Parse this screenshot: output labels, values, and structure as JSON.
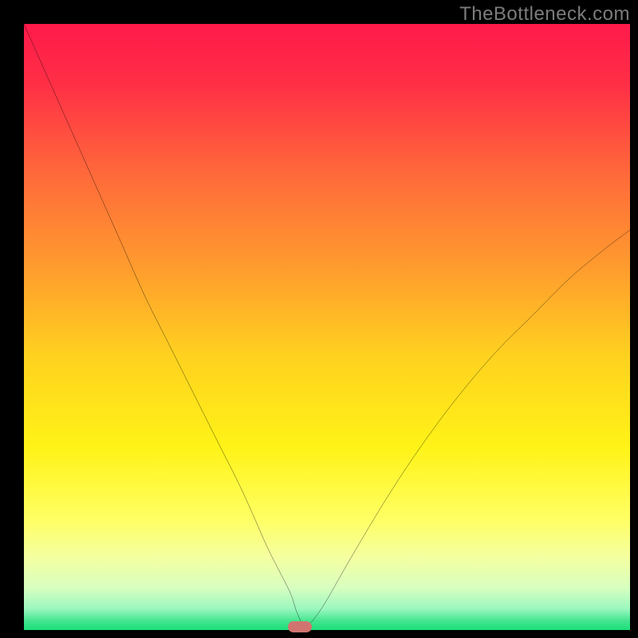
{
  "watermark": "TheBottleneck.com",
  "colors": {
    "frame": "#000000",
    "watermark": "#7c7c7c",
    "curve": "#000000",
    "marker": "#d1746f",
    "gradient_stops": [
      {
        "offset": 0.0,
        "color": "#ff1a4a"
      },
      {
        "offset": 0.1,
        "color": "#ff2f46"
      },
      {
        "offset": 0.25,
        "color": "#ff6a3a"
      },
      {
        "offset": 0.4,
        "color": "#ff9b2e"
      },
      {
        "offset": 0.55,
        "color": "#ffd21f"
      },
      {
        "offset": 0.7,
        "color": "#fff317"
      },
      {
        "offset": 0.82,
        "color": "#ffff66"
      },
      {
        "offset": 0.88,
        "color": "#f4ffa0"
      },
      {
        "offset": 0.93,
        "color": "#d8ffc0"
      },
      {
        "offset": 0.965,
        "color": "#9bf7bf"
      },
      {
        "offset": 0.985,
        "color": "#43e58f"
      },
      {
        "offset": 1.0,
        "color": "#1adf7a"
      }
    ]
  },
  "chart_data": {
    "type": "line",
    "title": "",
    "xlabel": "",
    "ylabel": "",
    "xlim": [
      0,
      100
    ],
    "ylim": [
      0,
      100
    ],
    "grid": false,
    "series": [
      {
        "name": "bottleneck-curve",
        "x": [
          0,
          4,
          8,
          12,
          16,
          20,
          24,
          28,
          32,
          36,
          40,
          42,
          44,
          45,
          46,
          47,
          48,
          50,
          54,
          60,
          66,
          72,
          78,
          84,
          90,
          96,
          100
        ],
        "y": [
          100,
          91,
          82,
          73,
          64,
          55,
          47,
          39,
          31,
          23,
          14,
          10,
          6,
          3,
          1,
          1,
          2,
          5,
          12,
          22,
          31,
          39,
          46,
          52,
          58,
          63,
          66
        ]
      }
    ],
    "annotations": [
      {
        "name": "optimal-marker",
        "x": 45.5,
        "y": 0.5
      }
    ]
  }
}
